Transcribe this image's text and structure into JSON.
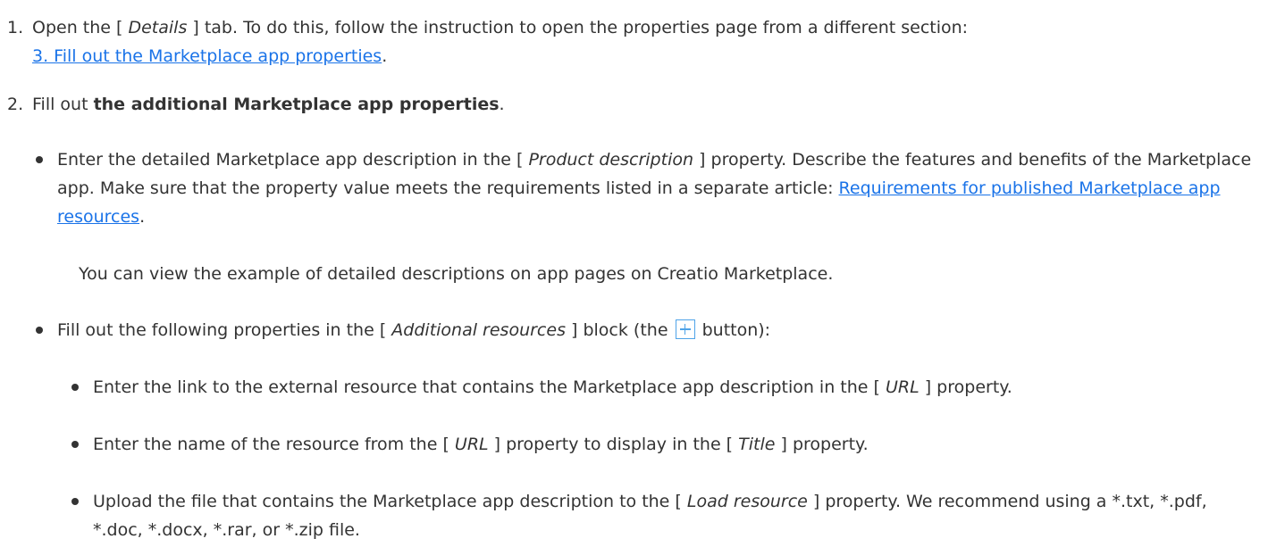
{
  "steps": [
    {
      "number": "1.",
      "pre": "Open the [ ",
      "term": "Details",
      "post": " ] tab. To do this, follow the instruction to open the properties page from a different section:",
      "link": "3. Fill out the Marketplace app properties",
      "link_suffix": "."
    },
    {
      "number": "2.",
      "pre": "Fill out ",
      "bold": "the additional Marketplace app properties",
      "post": "."
    }
  ],
  "bullets": {
    "product_description": {
      "pre": "Enter the detailed Marketplace app description in the [ ",
      "term": "Product description",
      "post": " ] property. Describe the features and benefits of the Marketplace app. Make sure that the property value meets the requirements listed in a separate article: ",
      "link": "Requirements for published Marketplace app resources",
      "link_suffix": "."
    },
    "example_note": "You can view the example of detailed descriptions on app pages on Creatio Marketplace.",
    "additional_resources": {
      "pre": "Fill out the following properties in the [ ",
      "term": "Additional resources",
      "mid": " ] block (the ",
      "post": " button):",
      "button_icon": "plus-icon"
    },
    "sub": [
      {
        "pre": "Enter the link to the external resource that contains the Marketplace app description in the [ ",
        "term": "URL",
        "post": " ] property."
      },
      {
        "pre": "Enter the name of the resource from the [ ",
        "term": "URL",
        "mid": " ] property to display in the [ ",
        "term2": "Title",
        "post": " ] property."
      },
      {
        "pre": "Upload the file that contains the Marketplace app description to the [ ",
        "term": "Load resource",
        "post": " ] property. We recommend using a *.txt, *.pdf, *.doc, *.docx, *.rar, or *.zip file."
      }
    ]
  },
  "colors": {
    "text": "#333333",
    "link": "#1a73e8",
    "button_border": "#4fa3e8"
  }
}
